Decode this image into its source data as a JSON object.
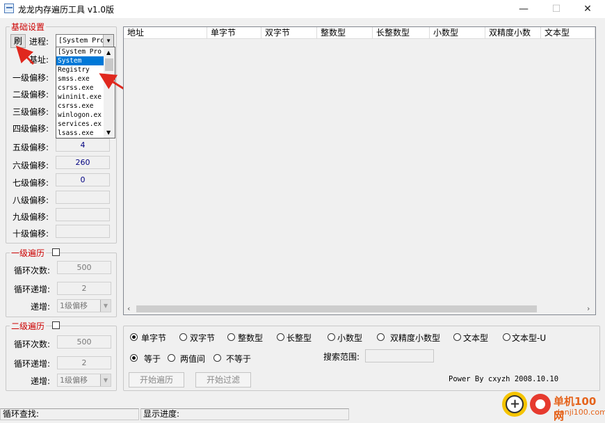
{
  "window": {
    "title": "龙龙内存遍历工具 v1.0版",
    "minimize": "—",
    "maximize": "☐",
    "close": "✕"
  },
  "basic": {
    "group_label": "基础设置",
    "refresh_label": "刷",
    "process_label": "进程:",
    "process_value": "[System Pro",
    "base_label": "基址:",
    "process_list": [
      "[System Pro",
      "System",
      "Registry",
      "smss.exe",
      "csrss.exe",
      "wininit.exe",
      "csrss.exe",
      "winlogon.ex",
      "services.ex",
      "lsass.exe"
    ],
    "offsets": [
      {
        "label": "一级偏移:",
        "value": ""
      },
      {
        "label": "二级偏移:",
        "value": ""
      },
      {
        "label": "三级偏移:",
        "value": ""
      },
      {
        "label": "四级偏移:",
        "value": ""
      },
      {
        "label": "五级偏移:",
        "value": "4"
      },
      {
        "label": "六级偏移:",
        "value": "260"
      },
      {
        "label": "七级偏移:",
        "value": "0"
      },
      {
        "label": "八级偏移:",
        "value": ""
      },
      {
        "label": "九级偏移:",
        "value": ""
      },
      {
        "label": "十级偏移:",
        "value": ""
      }
    ]
  },
  "level1": {
    "group_label": "一级遍历",
    "loop_count_label": "循环次数:",
    "loop_count": "500",
    "loop_inc_label": "循环递增:",
    "loop_inc": "2",
    "inc_label": "递增:",
    "inc_value": "1级偏移"
  },
  "level2": {
    "group_label": "二级遍历",
    "loop_count_label": "循环次数:",
    "loop_count": "500",
    "loop_inc_label": "循环递增:",
    "loop_inc": "2",
    "inc_label": "递增:",
    "inc_value": "1级偏移"
  },
  "listview": {
    "columns": [
      "地址",
      "单字节",
      "双字节",
      "整数型",
      "长整数型",
      "小数型",
      "双精度小数",
      "文本型"
    ]
  },
  "search": {
    "types": [
      "单字节",
      "双字节",
      "整数型",
      "长整型",
      "小数型",
      "双精度小数型",
      "文本型",
      "文本型-U"
    ],
    "selected_type": "单字节",
    "conditions": [
      "等于",
      "两值间",
      "不等于"
    ],
    "selected_condition": "等于",
    "range_label": "搜索范围:",
    "range_value": "",
    "start_button": "开始遍历",
    "filter_button": "开始过滤",
    "credit": "Power By cxyzh 2008.10.10"
  },
  "status": {
    "loop_find": "循环查找:",
    "progress": "显示进度:"
  },
  "watermark": {
    "cn": "单机100网",
    "url": "danji100.com"
  }
}
